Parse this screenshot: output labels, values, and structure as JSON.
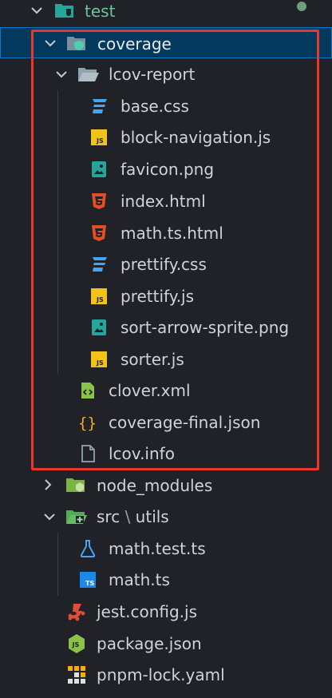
{
  "colors": {
    "background": "#202227",
    "selected_bg": "#04395e",
    "highlight_box": "#e8382b",
    "css_icon": "#42a5f5",
    "js_icon": "#f2c31b",
    "html_icon": "#e44d26",
    "image_icon": "#26a69a",
    "xml_icon": "#8bc34a",
    "json_icon": "#f9a825",
    "info_icon": "#90a4ae",
    "folder_icon": "#90a4ae"
  },
  "tree": {
    "test": {
      "label": "test",
      "icon": "test-folder-icon"
    },
    "coverage": {
      "label": "coverage",
      "icon": "coverage-folder-icon"
    },
    "lcov_report": {
      "label": "lcov-report",
      "icon": "folder-open-icon"
    },
    "files_lcov": [
      {
        "label": "base.css",
        "icon": "css-file-icon"
      },
      {
        "label": "block-navigation.js",
        "icon": "js-file-icon"
      },
      {
        "label": "favicon.png",
        "icon": "image-file-icon"
      },
      {
        "label": "index.html",
        "icon": "html-file-icon"
      },
      {
        "label": "math.ts.html",
        "icon": "html-file-icon"
      },
      {
        "label": "prettify.css",
        "icon": "css-file-icon"
      },
      {
        "label": "prettify.js",
        "icon": "js-file-icon"
      },
      {
        "label": "sort-arrow-sprite.png",
        "icon": "image-file-icon"
      },
      {
        "label": "sorter.js",
        "icon": "js-file-icon"
      }
    ],
    "files_coverage": [
      {
        "label": "clover.xml",
        "icon": "xml-file-icon"
      },
      {
        "label": "coverage-final.json",
        "icon": "json-file-icon"
      },
      {
        "label": "lcov.info",
        "icon": "info-file-icon"
      }
    ],
    "node_modules": {
      "label": "node_modules",
      "icon": "node-folder-icon"
    },
    "src_utils": {
      "label_a": "src",
      "sep": "\\",
      "label_b": "utils",
      "icon": "src-folder-icon"
    },
    "files_utils": [
      {
        "label": "math.test.ts",
        "icon": "test-file-icon"
      },
      {
        "label": "math.ts",
        "icon": "ts-file-icon"
      }
    ],
    "root_files": [
      {
        "label": "jest.config.js",
        "icon": "jest-file-icon"
      },
      {
        "label": "package.json",
        "icon": "npm-file-icon"
      },
      {
        "label": "pnpm-lock.yaml",
        "icon": "pnpm-file-icon"
      }
    ]
  }
}
